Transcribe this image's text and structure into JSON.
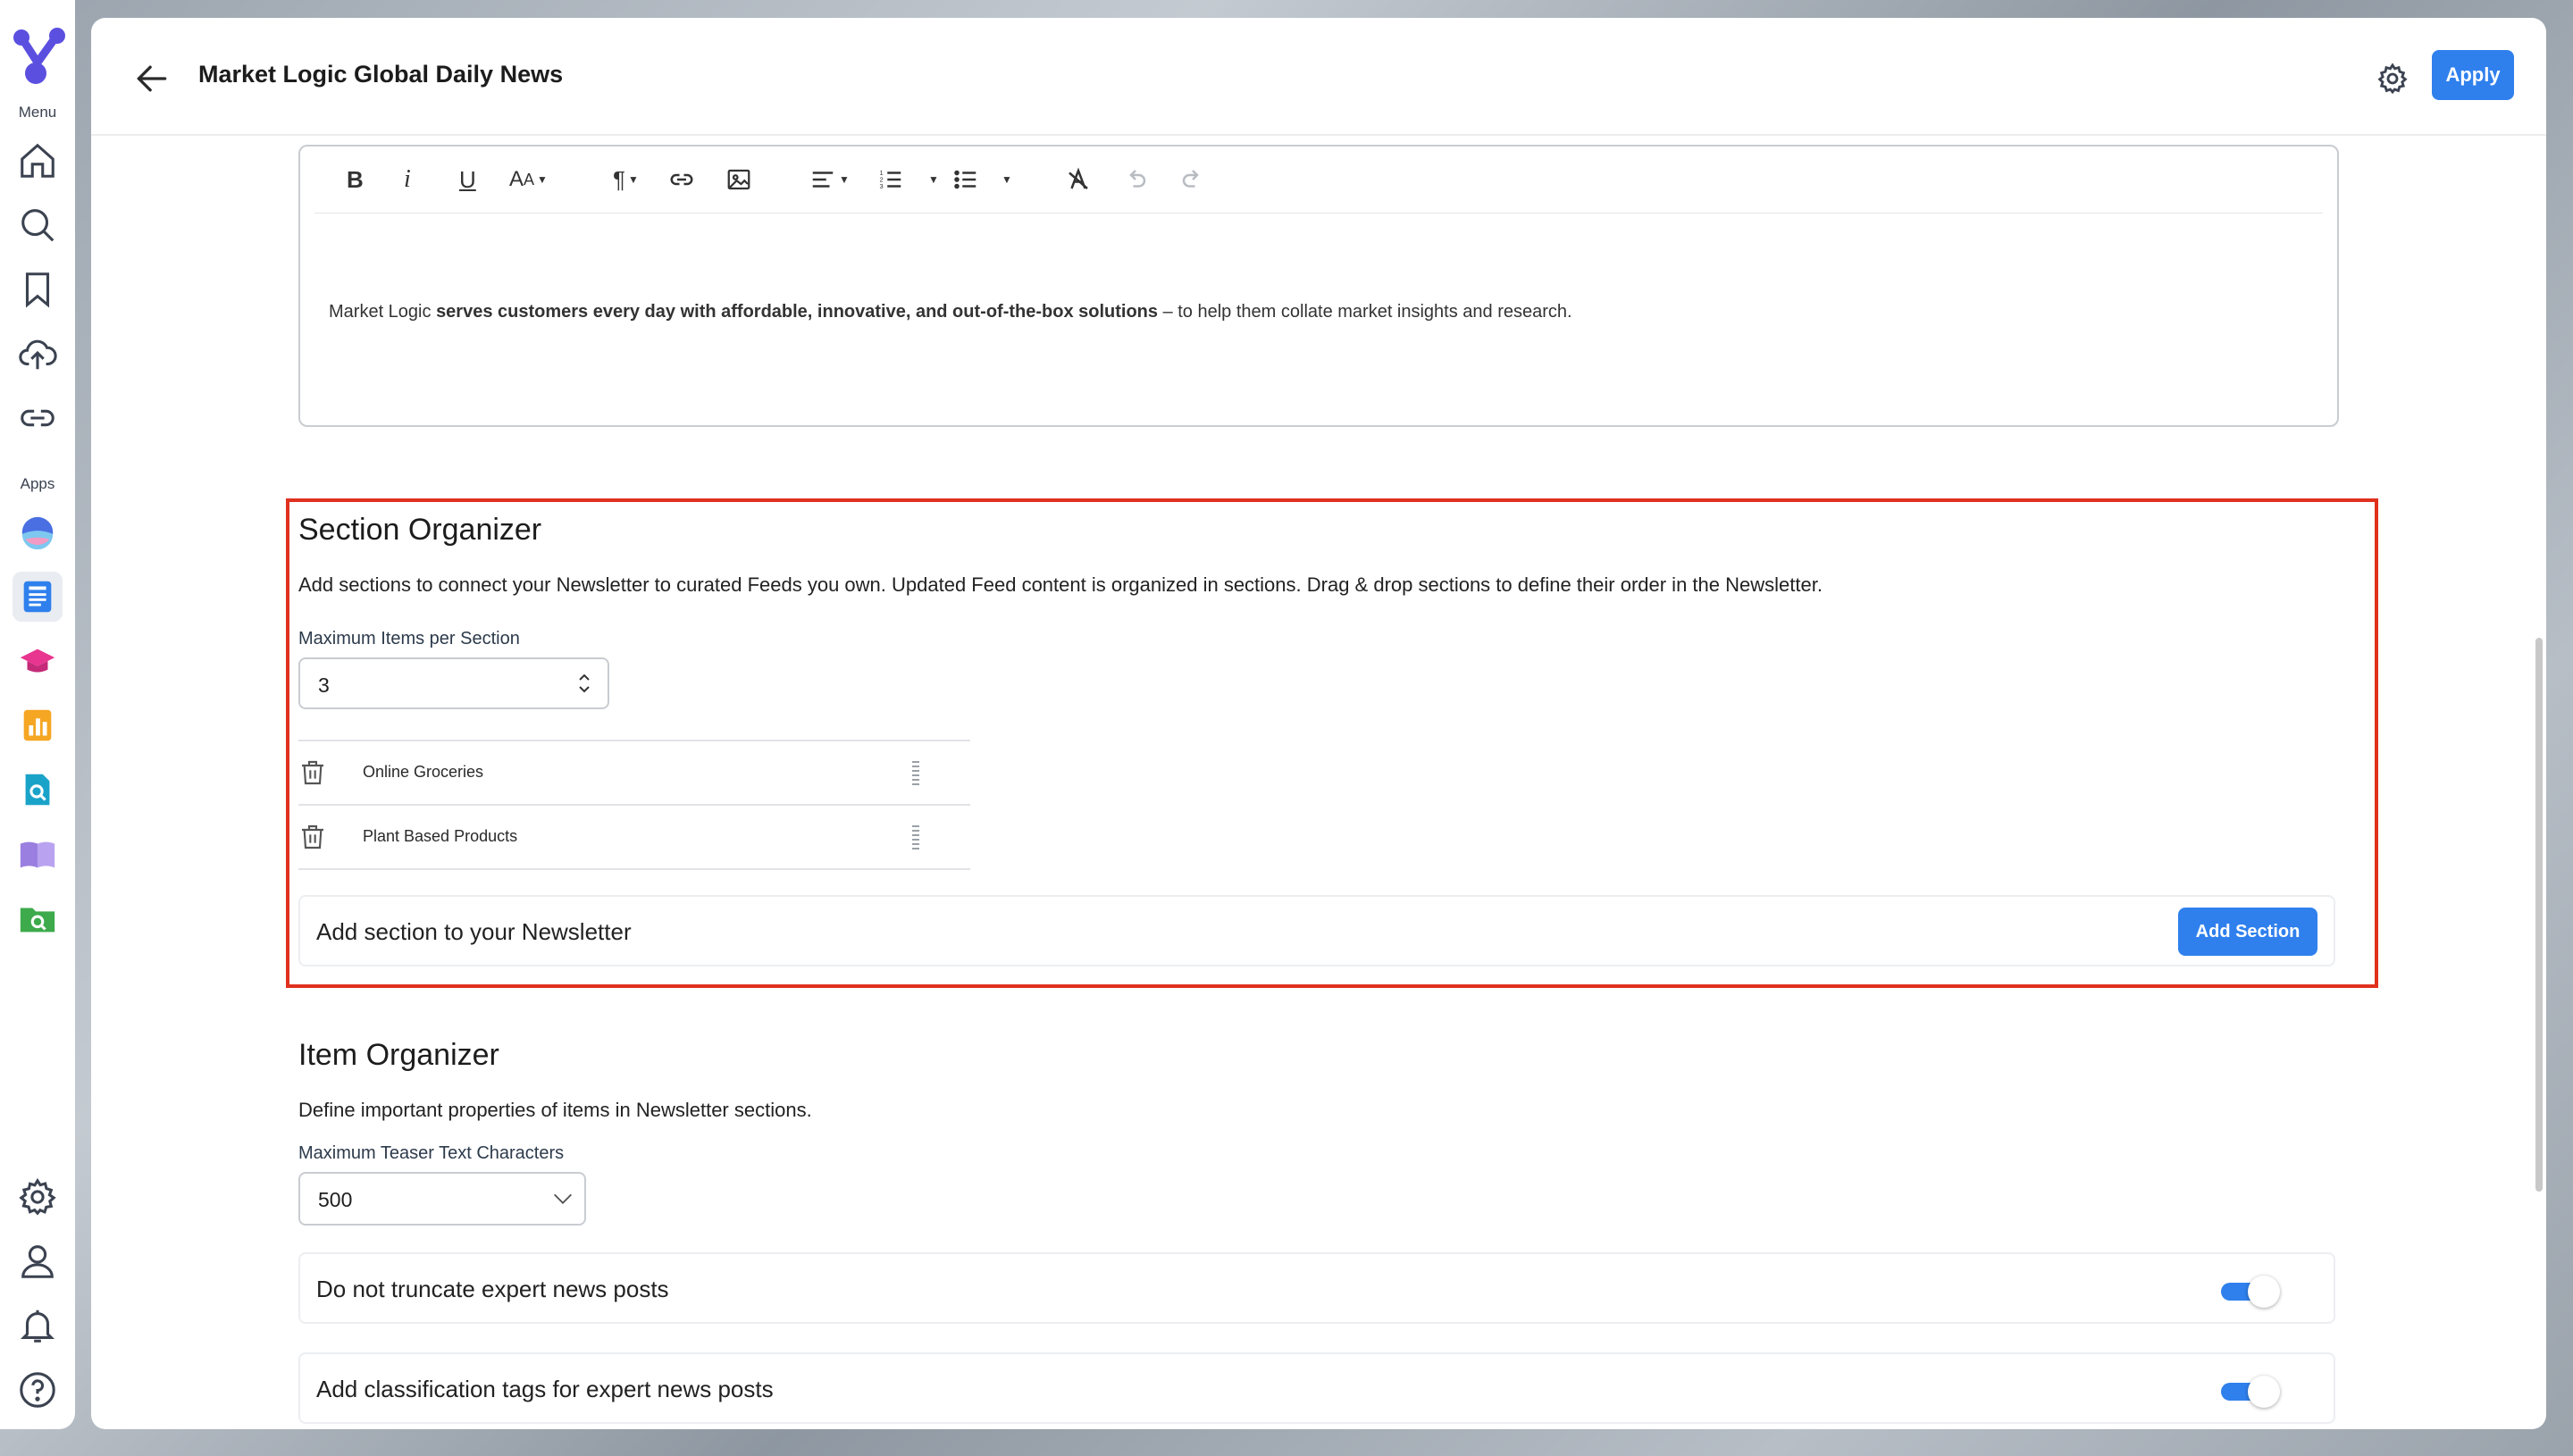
{
  "rail": {
    "menu_caption": "Menu",
    "apps_caption": "Apps",
    "colors": {
      "icon": "#3b4250",
      "logo": "#5b4fe0"
    }
  },
  "header": {
    "title": "Market Logic Global Daily News",
    "apply_label": "Apply"
  },
  "editor": {
    "text_prefix": "Market Logic ",
    "text_bold": "serves customers every day with affordable, innovative, and out-of-the-box solutions",
    "text_suffix": " – to help them collate market insights and research."
  },
  "section_organizer": {
    "title": "Section Organizer",
    "description": "Add sections to connect your Newsletter to curated Feeds you own. Updated Feed content is organized in sections. Drag & drop sections to define their order in the Newsletter.",
    "max_items_label": "Maximum Items per Section",
    "max_items_value": "3",
    "sections": [
      {
        "name": "Online Groceries"
      },
      {
        "name": "Plant Based Products"
      }
    ],
    "add_prompt": "Add section to your Newsletter",
    "add_button_label": "Add Section"
  },
  "item_organizer": {
    "title": "Item Organizer",
    "description": "Define important properties of items in Newsletter sections.",
    "teaser_label": "Maximum Teaser Text Characters",
    "teaser_value": "500",
    "toggles": [
      {
        "label": "Do not truncate expert news posts",
        "on": true
      },
      {
        "label": "Add classification tags for expert news posts",
        "on": true
      }
    ]
  },
  "colors": {
    "accent": "#2f80ed",
    "highlight": "#e0301e"
  }
}
